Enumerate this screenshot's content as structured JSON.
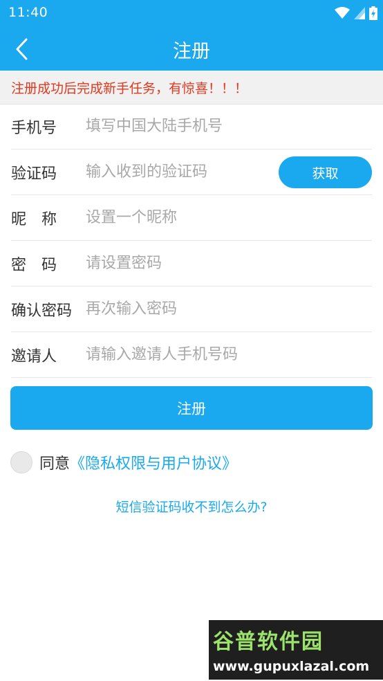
{
  "status_bar": {
    "time": "11:40"
  },
  "app_bar": {
    "title": "注册"
  },
  "notice": "注册成功后完成新手任务，有惊喜！！！",
  "form": {
    "phone": {
      "label": "手机号",
      "placeholder": "填写中国大陆手机号"
    },
    "code": {
      "label": "验证码",
      "placeholder": "输入收到的验证码",
      "button": "获取"
    },
    "nickname": {
      "label": "昵　称",
      "placeholder": "设置一个昵称"
    },
    "password": {
      "label": "密　码",
      "placeholder": "请设置密码"
    },
    "confirm": {
      "label": "确认密码",
      "placeholder": "再次输入密码"
    },
    "inviter": {
      "label": "邀请人",
      "placeholder": "请输入邀请人手机号码"
    }
  },
  "register_button": "注册",
  "agreement": {
    "prefix": "同意",
    "link": "《隐私权限与用户协议》"
  },
  "sms_help": "短信验证码收不到怎么办?",
  "watermark": {
    "top": "谷普软件园",
    "bottom": "www.gupuxlazal.com"
  },
  "colors": {
    "primary": "#1aa9ef",
    "notice_text": "#e0391f"
  }
}
